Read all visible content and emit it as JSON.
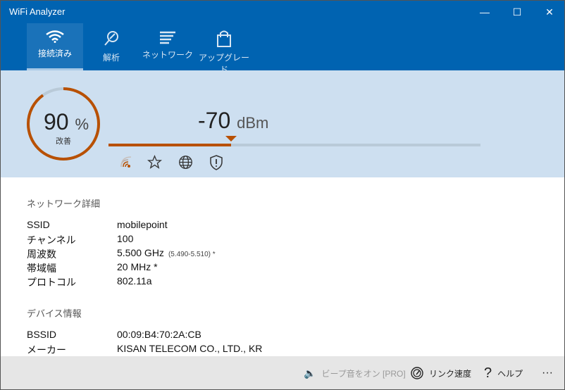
{
  "window": {
    "title": "WiFi Analyzer"
  },
  "tabs": [
    {
      "label": "接続済み",
      "icon": "wifi-icon"
    },
    {
      "label": "解析",
      "icon": "analyze-icon"
    },
    {
      "label": "ネットワーク",
      "icon": "network-list-icon"
    },
    {
      "label": "アップグレード",
      "icon": "shopping-bag-icon"
    }
  ],
  "signal": {
    "percent": "90",
    "percent_unit": "%",
    "percent_value": 0.9,
    "quality": "改善",
    "dbm": "-70",
    "dbm_unit": "dBm",
    "bar_fraction": 0.33
  },
  "colors": {
    "accent": "#b85000",
    "header": "#0063b1"
  },
  "network_details": {
    "heading": "ネットワーク詳細",
    "rows": [
      {
        "label": "SSID",
        "value": "mobilepoint"
      },
      {
        "label": "チャンネル",
        "value": "100"
      },
      {
        "label": "周波数",
        "value": "5.500 GHz",
        "extra": "(5.490-5.510) *"
      },
      {
        "label": "帯域幅",
        "value": "20 MHz *"
      },
      {
        "label": "プロトコル",
        "value": "802.11a"
      }
    ]
  },
  "device_info": {
    "heading": "デバイス情報",
    "rows": [
      {
        "label": "BSSID",
        "value": "00:09:B4:70:2A:CB"
      },
      {
        "label": "メーカー",
        "value": "KISAN TELECOM CO., LTD., KR"
      }
    ]
  },
  "footer": {
    "beep": "ビープ音をオン [PRO]",
    "link_speed": "リンク速度",
    "help": "ヘルプ",
    "more": "···"
  }
}
